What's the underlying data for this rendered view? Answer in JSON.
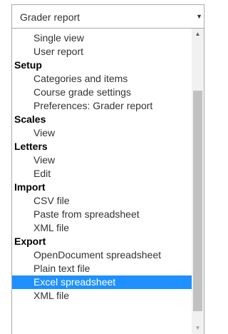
{
  "select": {
    "value": "Grader report",
    "arrow_icon": "triangle-down"
  },
  "dropdown": {
    "groups": [
      {
        "label": "",
        "items": [
          "Single view",
          "User report"
        ]
      },
      {
        "label": "Setup",
        "items": [
          "Categories and items",
          "Course grade settings",
          "Preferences: Grader report"
        ]
      },
      {
        "label": "Scales",
        "items": [
          "View"
        ]
      },
      {
        "label": "Letters",
        "items": [
          "View",
          "Edit"
        ]
      },
      {
        "label": "Import",
        "items": [
          "CSV file",
          "Paste from spreadsheet",
          "XML file"
        ]
      },
      {
        "label": "Export",
        "items": [
          "OpenDocument spreadsheet",
          "Plain text file",
          "Excel spreadsheet",
          "XML file"
        ]
      }
    ],
    "selected": "Excel spreadsheet",
    "selected_color": "#1e90ff",
    "scroll_position": 0.82,
    "scroll_visible_fraction": 0.78
  }
}
